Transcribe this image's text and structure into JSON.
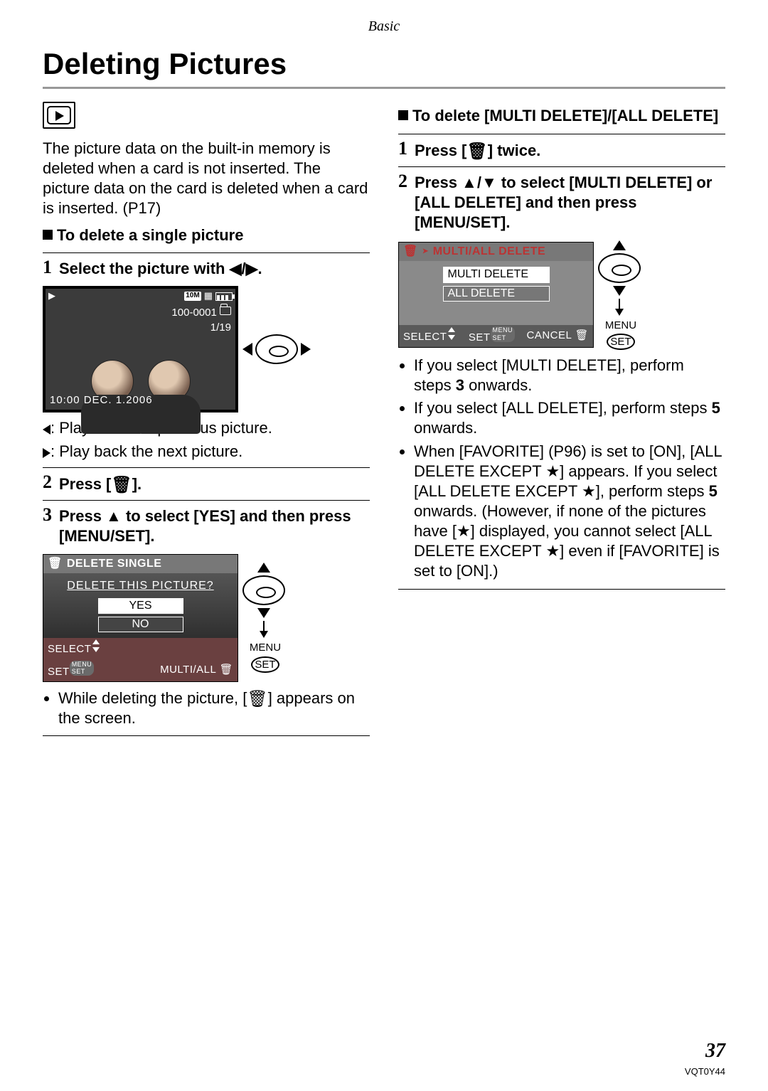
{
  "page": {
    "section": "Basic",
    "title": "Deleting Pictures",
    "page_number": "37",
    "doc_code": "VQT0Y44"
  },
  "left": {
    "intro": "The picture data on the built-in memory is deleted when a card is not inserted. The picture data on the card is deleted when a card is inserted. (P17)",
    "subhead_single": "To delete a single picture",
    "step1": "Select the picture with ◀/▶.",
    "lcd": {
      "res_badge": "10M",
      "file": "100-0001",
      "counter": "1/19",
      "datetime": "10:00  DEC.  1.2006"
    },
    "legend_prev": ": Play back the previous picture.",
    "legend_next": ": Play back the next picture.",
    "step2_a": "Press [",
    "step2_b": "].",
    "step3": "Press ▲ to select [YES] and then press [MENU/SET].",
    "dlg": {
      "header": "DELETE SINGLE",
      "question": "DELETE  THIS  PICTURE?",
      "yes": "YES",
      "no": "NO",
      "select": "SELECT",
      "set": "SET",
      "multiall": "MULTI/ALL"
    },
    "menu_label": "MENU",
    "set_label": "SET",
    "note_a": "While deleting the picture, [",
    "note_b": "] appears on the screen."
  },
  "right": {
    "subhead_multi": "To delete [MULTI DELETE]/[ALL DELETE]",
    "step1_a": "Press [",
    "step1_b": "] twice.",
    "step2": "Press ▲/▼ to select [MULTI DELETE] or [ALL DELETE] and then press [MENU/SET].",
    "dlg": {
      "header": "MULTI/ALL DELETE",
      "multi": "MULTI DELETE",
      "all": "ALL DELETE",
      "select": "SELECT",
      "set": "SET",
      "cancel": "CANCEL"
    },
    "menu_label": "MENU",
    "set_label": "SET",
    "bul1_a": "If you select [MULTI DELETE], perform steps ",
    "bul1_b": "3",
    "bul1_c": " onwards.",
    "bul2_a": "If you select [ALL DELETE], perform steps ",
    "bul2_b": "5",
    "bul2_c": " onwards.",
    "bul3_a": "When [FAVORITE] (P96) is set to [ON], [ALL DELETE EXCEPT ",
    "bul3_b": "] appears. If you select [ALL DELETE EXCEPT ",
    "bul3_c": "], perform steps ",
    "bul3_d": "5",
    "bul3_e": " onwards. (However, if none of the pictures have [",
    "bul3_f": "] displayed, you cannot select [ALL DELETE EXCEPT ",
    "bul3_g": "] even if [FAVORITE] is set to [ON].)"
  }
}
